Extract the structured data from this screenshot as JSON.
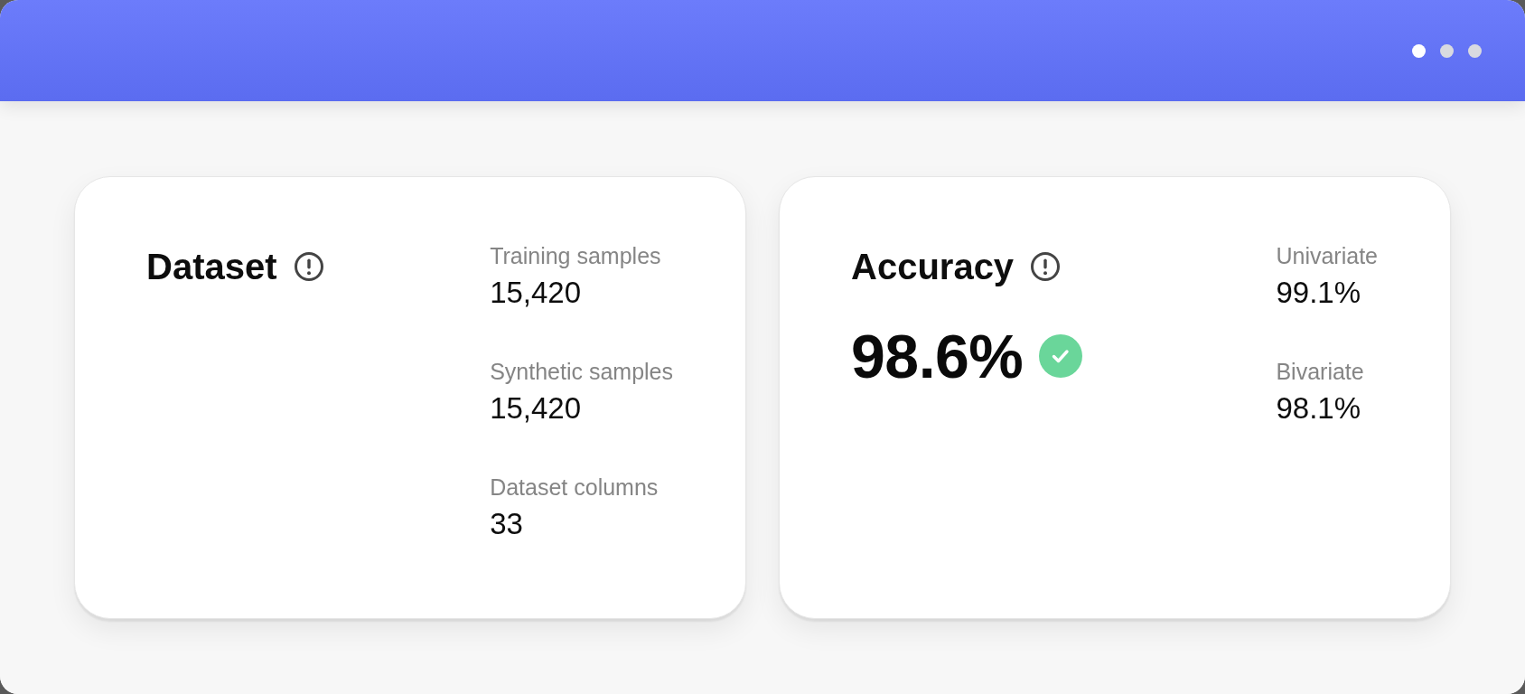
{
  "window": {
    "page_dots": [
      {
        "selected": true
      },
      {
        "selected": false
      },
      {
        "selected": false
      }
    ]
  },
  "cards": [
    {
      "title": "Dataset",
      "stats": [
        {
          "label": "Training samples",
          "value": "15,420"
        },
        {
          "label": "Synthetic samples",
          "value": "15,420"
        },
        {
          "label": "Dataset columns",
          "value": "33"
        }
      ]
    },
    {
      "title": "Accuracy",
      "headline": {
        "value": "98.6%",
        "passed": true
      },
      "stats": [
        {
          "label": "Univariate",
          "value": "99.1%"
        },
        {
          "label": "Bivariate",
          "value": "98.1%"
        }
      ]
    }
  ]
}
